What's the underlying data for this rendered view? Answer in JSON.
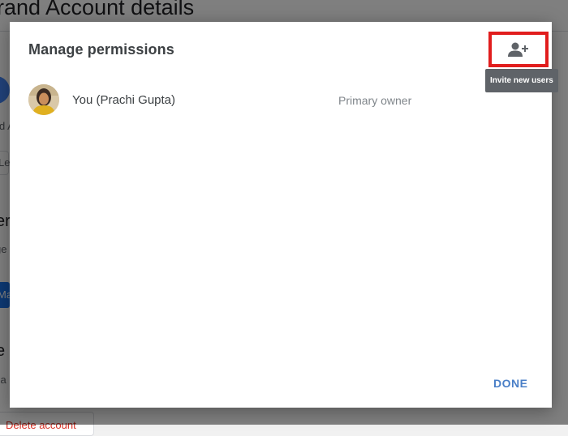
{
  "background": {
    "title": "rand Account details",
    "fragments": [
      "d A",
      "Le",
      "er",
      "ge",
      "Ma",
      "e",
      "ca"
    ],
    "delete_label": "Delete account"
  },
  "dialog": {
    "title": "Manage permissions",
    "invite": {
      "icon": "add-person-icon",
      "tooltip": "Invite new users"
    },
    "users": [
      {
        "name": "You (Prachi Gupta)",
        "role": "Primary owner"
      }
    ],
    "done_label": "DONE"
  },
  "colors": {
    "highlight_border": "#e11d1d",
    "done_text": "#4a7fc7",
    "tooltip_bg": "#5f6368"
  }
}
